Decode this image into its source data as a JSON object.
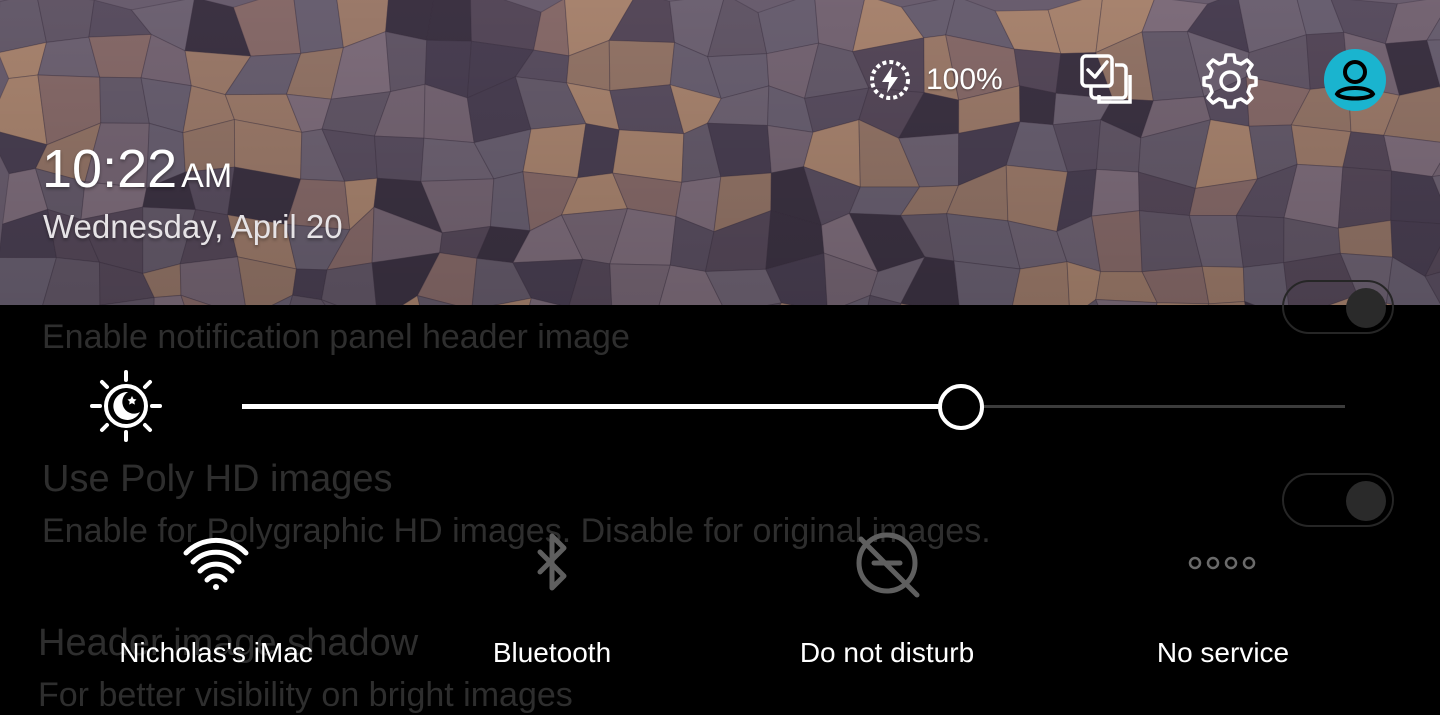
{
  "header": {
    "battery": {
      "icon": "battery-charging-icon",
      "text": "100%"
    },
    "actions": [
      {
        "name": "edit",
        "icon": "edit-tiles-icon"
      },
      {
        "name": "settings",
        "icon": "gear-icon"
      },
      {
        "name": "account",
        "icon": "account-icon",
        "color": "#1ab4cf"
      }
    ],
    "clock": {
      "time": "10:22",
      "ampm": "AM"
    },
    "date": "Wednesday, April 20"
  },
  "background_settings": [
    {
      "title": "",
      "subtitle": "Enable notification panel header image",
      "toggle": true
    },
    {
      "title": "Use Poly HD images",
      "subtitle": "Enable for Polygraphic HD images. Disable for original images.",
      "toggle": true
    },
    {
      "title": "Header image shadow",
      "subtitle": "For better visibility on bright images",
      "toggle": false
    }
  ],
  "brightness": {
    "icon": "auto-brightness-icon",
    "level": 0.652
  },
  "tiles": [
    {
      "label": "Nicholas's iMac",
      "icon": "wifi-icon",
      "active": true
    },
    {
      "label": "Bluetooth",
      "icon": "bluetooth-off-icon",
      "active": false
    },
    {
      "label": "Do not disturb",
      "icon": "do-not-disturb-icon",
      "active": false
    },
    {
      "label": "No service",
      "icon": "no-service-icon",
      "active": false
    }
  ]
}
